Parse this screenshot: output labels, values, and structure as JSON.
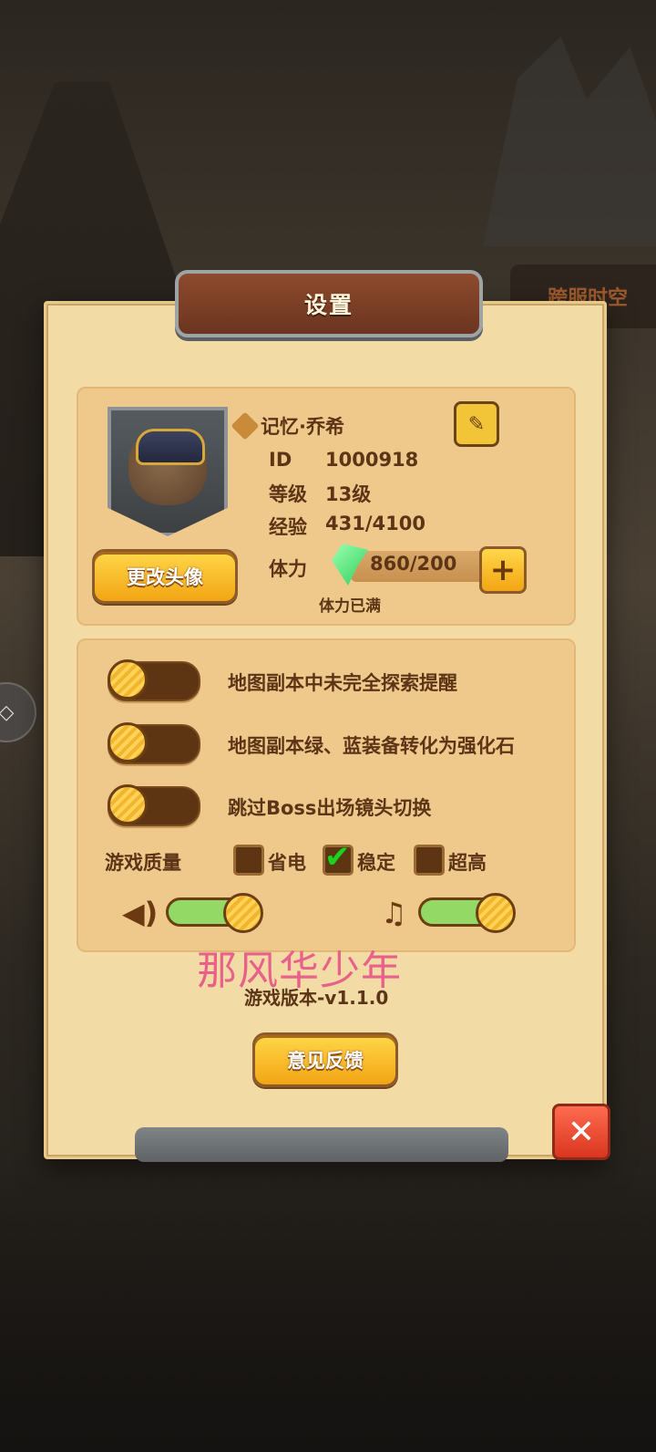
{
  "background": {
    "sign_text": "跨服时空"
  },
  "dialog": {
    "title": "设置"
  },
  "profile": {
    "name": "记忆·乔希",
    "id_label": "ID",
    "id_value": "1000918",
    "level_label": "等级",
    "level_value": "13级",
    "exp_label": "经验",
    "exp_value": "431/4100",
    "stamina_label": "体力",
    "stamina_value": "860/200",
    "stamina_status": "体力已满",
    "change_avatar_label": "更改头像"
  },
  "options": [
    {
      "label": "地图副本中未完全探索提醒",
      "enabled": false
    },
    {
      "label": "地图副本绿、蓝装备转化为强化石",
      "enabled": false
    },
    {
      "label": "跳过Boss出场镜头切换",
      "enabled": false
    }
  ],
  "quality": {
    "label": "游戏质量",
    "options": [
      {
        "label": "省电",
        "checked": false
      },
      {
        "label": "稳定",
        "checked": true
      },
      {
        "label": "超高",
        "checked": false
      }
    ]
  },
  "audio": {
    "sound_level": 1.0,
    "music_level": 1.0,
    "sound_icon": "speaker-icon",
    "music_icon": "music-note-icon"
  },
  "watermark": "那风华少年",
  "version": "游戏版本-v1.1.0",
  "feedback_label": "意见反馈",
  "colors": {
    "panel": "#f3dba6",
    "title_plate": "#7a3f25",
    "button": "#f7b928",
    "close": "#e14a2f"
  }
}
